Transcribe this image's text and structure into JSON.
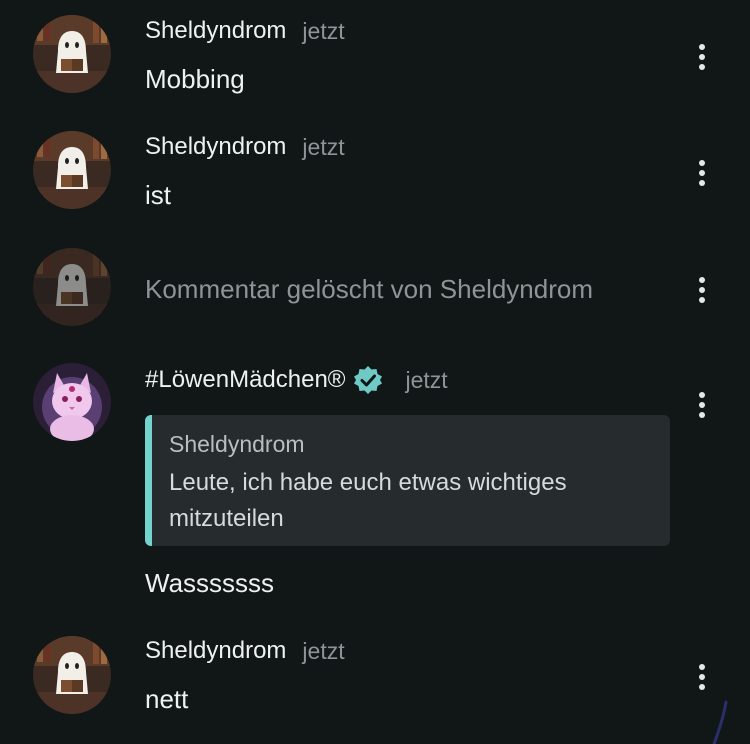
{
  "comments": [
    {
      "author": "Sheldyndrom",
      "time": "jetzt",
      "text": "Mobbing"
    },
    {
      "author": "Sheldyndrom",
      "time": "jetzt",
      "text": "ist"
    },
    {
      "deleted_text": "Kommentar gelöscht von Sheldyndrom"
    },
    {
      "author": "#LöwenMädchen®",
      "time": "jetzt",
      "quote": {
        "author": "Sheldyndrom",
        "text": "Leute, ich habe euch etwas wichtiges mitzuteilen"
      },
      "text": "Wasssssss"
    },
    {
      "author": "Sheldyndrom",
      "time": "jetzt",
      "text": "nett"
    }
  ],
  "icons": {
    "menu": "more-vertical-icon",
    "verified": "verified-badge-icon",
    "avatar_ghost": "ghost-reading-avatar",
    "avatar_cat": "pink-cat-avatar"
  },
  "colors": {
    "background": "#111617",
    "quote_accent": "#73d3cd",
    "verified": "#6fc9c4"
  }
}
